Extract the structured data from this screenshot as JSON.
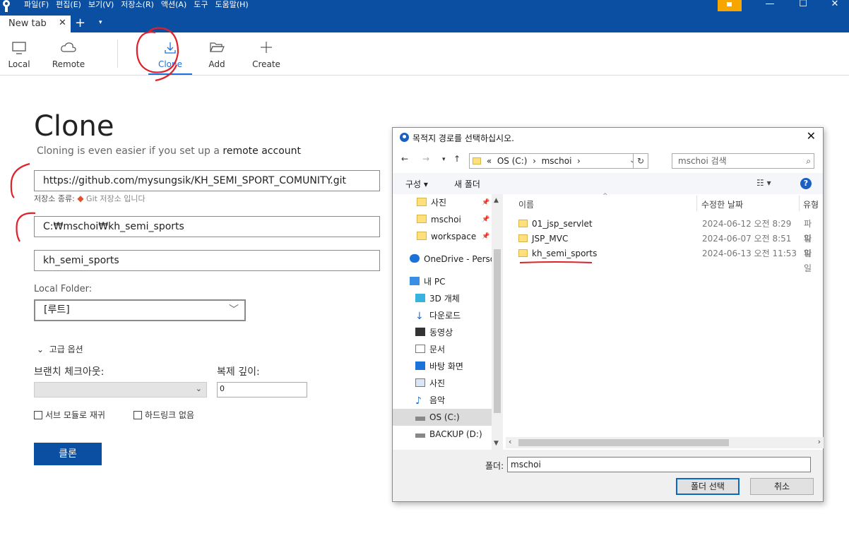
{
  "app": {
    "menus": [
      "파일(F)",
      "편집(E)",
      "보기(V)",
      "저장소(R)",
      "액션(A)",
      "도구",
      "도움말(H)"
    ],
    "window_controls": {
      "minimize": "—",
      "maximize": "☐",
      "close": "✕"
    }
  },
  "tabs": {
    "active_label": "New tab",
    "close_glyph": "✕",
    "add_glyph": "+",
    "dropdown_glyph": "▾"
  },
  "toolbar": {
    "items": [
      {
        "label": "Local",
        "icon": "monitor-icon"
      },
      {
        "label": "Remote",
        "icon": "cloud-icon"
      },
      {
        "label": "Clone",
        "icon": "download-icon",
        "active": true
      },
      {
        "label": "Add",
        "icon": "folder-open-icon"
      },
      {
        "label": "Create",
        "icon": "plus-icon"
      }
    ]
  },
  "clone_page": {
    "title": "Clone",
    "subtitle_prefix": "Cloning is even easier if you set up a ",
    "subtitle_link": "remote account",
    "source_url": "https://github.com/mysungsik/KH_SEMI_SPORT_COMUNITY.git",
    "repo_type_label": "저장소 종류:",
    "repo_type_value": "Git 저장소 입니다",
    "destination_path": "C:₩mschoi₩kh_semi_sports",
    "name": "kh_semi_sports",
    "local_folder_label": "Local Folder:",
    "local_folder_value": "[루트]",
    "advanced_label": "고급 옵션",
    "branch_label": "브랜치 체크아웃:",
    "depth_label": "복제 깊이:",
    "depth_value": "0",
    "submodules_label": "서브 모듈로 재귀",
    "no_hardlinks_label": "하드링크 없음",
    "clone_button": "클론"
  },
  "dialog": {
    "title": "목적지 경로를 선택하십시오.",
    "close_glyph": "✕",
    "address": {
      "prefix": "«",
      "parts": [
        "OS (C:)",
        "›",
        "mschoi",
        "›"
      ]
    },
    "search_placeholder": "mschoi 검색",
    "commands": {
      "organize": "구성 ▾",
      "new_folder": "새 폴더"
    },
    "nav_items": [
      {
        "label": "사진",
        "icon": "folder-icon",
        "pinned": true
      },
      {
        "label": "mschoi",
        "icon": "folder-icon",
        "pinned": true
      },
      {
        "label": "workspace",
        "icon": "folder-icon",
        "pinned": true
      },
      {
        "label": "OneDrive - Person",
        "icon": "onedrive-icon"
      },
      {
        "label": "내 PC",
        "icon": "pc-icon"
      },
      {
        "label": "3D 개체",
        "icon": "cube-icon"
      },
      {
        "label": "다운로드",
        "icon": "download-arrow-icon"
      },
      {
        "label": "동영상",
        "icon": "film-icon"
      },
      {
        "label": "문서",
        "icon": "document-icon"
      },
      {
        "label": "바탕 화면",
        "icon": "desktop-icon"
      },
      {
        "label": "사진",
        "icon": "picture-icon"
      },
      {
        "label": "음악",
        "icon": "music-icon"
      },
      {
        "label": "OS (C:)",
        "icon": "drive-icon",
        "selected": true
      },
      {
        "label": "BACKUP (D:)",
        "icon": "drive-icon"
      }
    ],
    "columns": {
      "name": "이름",
      "modified": "수정한 날짜",
      "type": "유형"
    },
    "files": [
      {
        "name": "01_jsp_servlet",
        "modified": "2024-06-12 오전 8:29",
        "type": "파일"
      },
      {
        "name": "JSP_MVC",
        "modified": "2024-06-07 오전 8:51",
        "type": "파일"
      },
      {
        "name": "kh_semi_sports",
        "modified": "2024-06-13 오전 11:53",
        "type": "파일"
      }
    ],
    "folder_label": "폴더:",
    "folder_value": "mschoi",
    "select_button": "폴더 선택",
    "cancel_button": "취소"
  },
  "colors": {
    "brand_blue": "#0b4fa3",
    "accent_blue": "#1a73d8",
    "annotation_red": "#e0202a",
    "flag": "#f7a600"
  }
}
